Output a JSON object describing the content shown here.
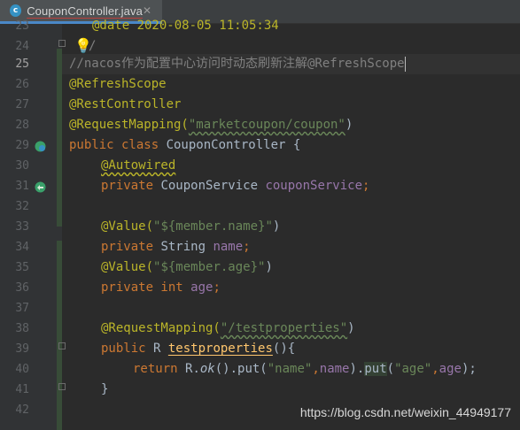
{
  "tab": {
    "label": "CouponController.java",
    "icon_letter": "c",
    "close": "✕"
  },
  "lines": [
    {
      "num": "23",
      "html_id": "l23"
    },
    {
      "num": "24",
      "html_id": "l24"
    },
    {
      "num": "25",
      "html_id": "l25"
    },
    {
      "num": "26",
      "html_id": "l26"
    },
    {
      "num": "27",
      "html_id": "l27"
    },
    {
      "num": "28",
      "html_id": "l28"
    },
    {
      "num": "29",
      "html_id": "l29"
    },
    {
      "num": "30",
      "html_id": "l30"
    },
    {
      "num": "31",
      "html_id": "l31"
    },
    {
      "num": "32",
      "html_id": "l32"
    },
    {
      "num": "33",
      "html_id": "l33"
    },
    {
      "num": "34",
      "html_id": "l34"
    },
    {
      "num": "35",
      "html_id": "l35"
    },
    {
      "num": "36",
      "html_id": "l36"
    },
    {
      "num": "37",
      "html_id": "l37"
    },
    {
      "num": "38",
      "html_id": "l38"
    },
    {
      "num": "39",
      "html_id": "l39"
    },
    {
      "num": "40",
      "html_id": "l40"
    },
    {
      "num": "41",
      "html_id": "l41"
    },
    {
      "num": "42",
      "html_id": "l42"
    }
  ],
  "code": {
    "l23": "@date 2020-08-05 11:05:34",
    "l25": "//nacos作为配置中心访问时动态刷新注解@RefreshScope",
    "l26": "@RefreshScope",
    "l27": "@RestController",
    "l28_ann": "@RequestMapping(",
    "l28_str": "\"marketcoupon/coupon\"",
    "l28_end": ")",
    "l29_kw": "public class ",
    "l29_rest": "CouponController {",
    "l30": "@Autowired",
    "l31_kw": "private ",
    "l31_type": "CouponService ",
    "l31_fld": "couponService",
    "l31_end": ";",
    "l33_ann": "@Value(",
    "l33_str": "\"${member.name}\"",
    "l33_end": ")",
    "l34_kw": "private ",
    "l34_type": "String ",
    "l34_fld": "name",
    "l34_end": ";",
    "l35_ann": "@Value(",
    "l35_str": "\"${member.age}\"",
    "l35_end": ")",
    "l36_kw": "private int ",
    "l36_fld": "age",
    "l36_end": ";",
    "l38_ann": "@RequestMapping(",
    "l38_str": "\"/testproperties\"",
    "l38_end": ")",
    "l39_kw": "public ",
    "l39_type": "R ",
    "l39_fn": "testproperties",
    "l39_end": "(){",
    "l40_kw": "return ",
    "l40_a": "R.",
    "l40_ok": "ok",
    "l40_b": "().put(",
    "l40_s1": "\"name\"",
    "l40_c": ",",
    "l40_f1": "name",
    "l40_d": ").",
    "l40_put": "put",
    "l40_e": "(",
    "l40_s2": "\"age\"",
    "l40_g": ",",
    "l40_f2": "age",
    "l40_h": ");",
    "l41": "}"
  },
  "watermark": "https://blog.csdn.net/weixin_44949177",
  "colors": {
    "background": "#2b2b2b",
    "gutter": "#313335",
    "keyword": "#cc7832",
    "annotation": "#bbb529",
    "string": "#6a8759",
    "field": "#9876aa"
  }
}
